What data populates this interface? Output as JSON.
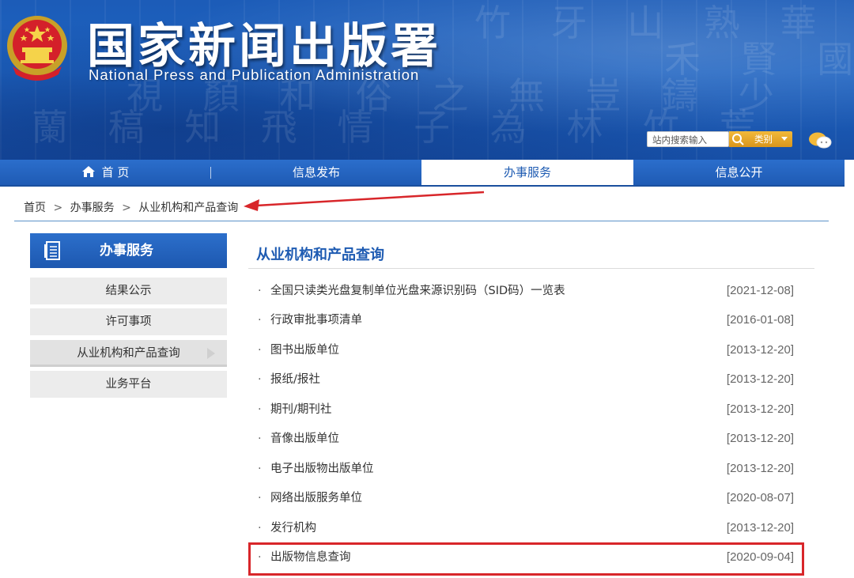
{
  "header": {
    "title": "国家新闻出版署",
    "subtitle": "National Press and Publication Administration",
    "search_placeholder": "站内搜索输入",
    "category_label": "类别"
  },
  "nav": {
    "items": [
      {
        "label": "首 页"
      },
      {
        "label": "信息发布"
      },
      {
        "label": "办事服务"
      },
      {
        "label": "信息公开"
      }
    ],
    "active_index": 2
  },
  "breadcrumb": {
    "items": [
      "首页",
      "办事服务",
      "从业机构和产品查询"
    ],
    "separator": ">"
  },
  "sidebar": {
    "heading": "办事服务",
    "items": [
      {
        "label": "结果公示"
      },
      {
        "label": "许可事项"
      },
      {
        "label": "从业机构和产品查询"
      },
      {
        "label": "业务平台"
      }
    ],
    "active_index": 2
  },
  "main": {
    "title": "从业机构和产品查询",
    "bullet": "·",
    "items": [
      {
        "title": "全国只读类光盘复制单位光盘来源识别码（SID码）一览表",
        "date": "[2021-12-08]"
      },
      {
        "title": "行政审批事项清单",
        "date": "[2016-01-08]"
      },
      {
        "title": "图书出版单位",
        "date": "[2013-12-20]"
      },
      {
        "title": "报纸/报社",
        "date": "[2013-12-20]"
      },
      {
        "title": "期刊/期刊社",
        "date": "[2013-12-20]"
      },
      {
        "title": "音像出版单位",
        "date": "[2013-12-20]"
      },
      {
        "title": "电子出版物出版单位",
        "date": "[2013-12-20]"
      },
      {
        "title": "网络出版服务单位",
        "date": "[2020-08-07]"
      },
      {
        "title": "发行机构",
        "date": "[2013-12-20]"
      },
      {
        "title": "出版物信息查询",
        "date": "[2020-09-04]"
      }
    ]
  },
  "colors": {
    "brand_blue": "#1e5bb2",
    "annotation_red": "#d8262a",
    "search_orange": "#e5a52a"
  }
}
